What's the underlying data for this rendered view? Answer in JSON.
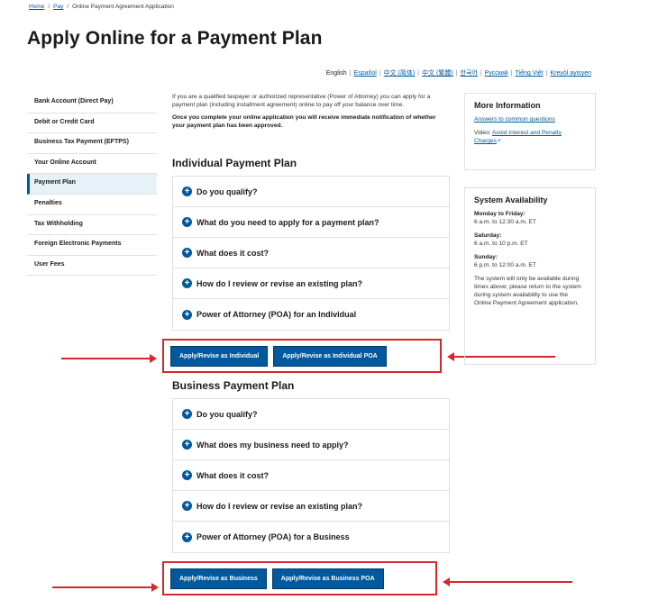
{
  "breadcrumb": {
    "home": "Home",
    "pay": "Pay",
    "current": "Online Payment Agreement Application"
  },
  "page_title": "Apply Online for a Payment Plan",
  "languages": [
    "English",
    "Español",
    "中文 (简体)",
    "中文 (繁體)",
    "한국어",
    "Русский",
    "Tiếng Việt",
    "Kreyòl ayisyen"
  ],
  "sidebar": {
    "items": [
      {
        "label": "Bank Account (Direct Pay)",
        "active": false
      },
      {
        "label": "Debit or Credit Card",
        "active": false
      },
      {
        "label": "Business Tax Payment (EFTPS)",
        "active": false
      },
      {
        "label": "Your Online Account",
        "active": false
      },
      {
        "label": "Payment Plan",
        "active": true
      },
      {
        "label": "Penalties",
        "active": false
      },
      {
        "label": "Tax Withholding",
        "active": false
      },
      {
        "label": "Foreign Electronic Payments",
        "active": false
      },
      {
        "label": "User Fees",
        "active": false
      }
    ]
  },
  "intro": {
    "text": "If you are a qualified taxpayer or authorized representative (Power of Attorney) you can apply for a payment plan (including installment agreement) online to pay off your balance over time.",
    "bold_text": "Once you complete your online application you will receive immediate notification of whether your payment plan has been approved."
  },
  "individual": {
    "heading": "Individual Payment Plan",
    "items": [
      "Do you qualify?",
      "What do you need to apply for a payment plan?",
      "What does it cost?",
      "How do I review or revise an existing plan?",
      "Power of Attorney (POA) for an Individual"
    ],
    "buttons": [
      "Apply/Revise as Individual",
      "Apply/Revise as Individual POA"
    ]
  },
  "business": {
    "heading": "Business Payment Plan",
    "items": [
      "Do you qualify?",
      "What does my business need to apply?",
      "What does it cost?",
      "How do I review or revise an existing plan?",
      "Power of Attorney (POA) for a Business"
    ],
    "buttons": [
      "Apply/Revise as Business",
      "Apply/Revise as Business POA"
    ]
  },
  "more_info": {
    "title": "More Information",
    "link1": "Answers to common questions",
    "video_prefix": "Video:",
    "video_link": "Avoid Interest and Penalty Charges"
  },
  "availability": {
    "title": "System Availability",
    "weekdays_label": "Monday to Friday:",
    "weekdays_hours": "6 a.m. to 12:30 a.m. ET",
    "saturday_label": "Saturday:",
    "saturday_hours": "6 a.m. to 10 p.m. ET",
    "sunday_label": "Sunday:",
    "sunday_hours": "6 p.m. to 12:00 a.m. ET",
    "note": "The system will only be available during times above; please return to the system during system availability to use the Online Payment Agreement application."
  },
  "colors": {
    "primary": "#00599c",
    "highlight": "#d9262b",
    "border": "#dfe1e2"
  }
}
